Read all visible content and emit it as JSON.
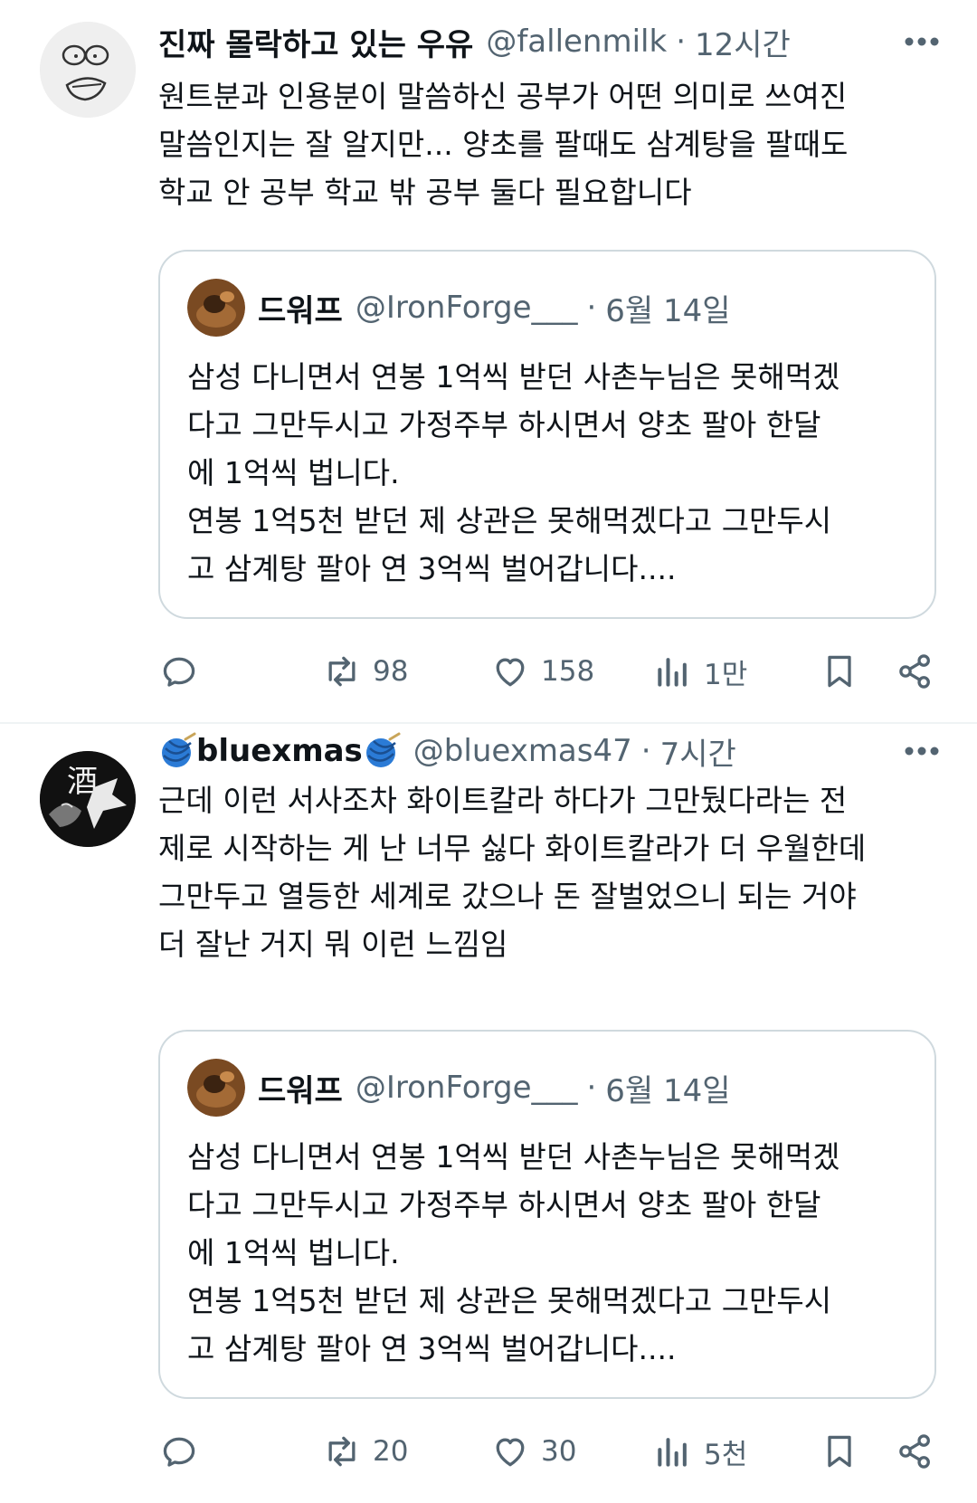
{
  "tweets": [
    {
      "display_name": "진짜 몰락하고 있는 우유",
      "handle": "@fallenmilk",
      "separator": "·",
      "time": "12시간",
      "text_lines": [
        "원트분과 인용분이 말씀하신 공부가 어떤 의미로 쓰여진",
        "말씀인지는 잘 알지만... 양초를 팔때도 삼계탕을 팔때도",
        "학교 안 공부 학교 밖 공부 둘다 필요합니다"
      ],
      "quote": {
        "display_name": "드워프",
        "handle": "@IronForge___",
        "separator": "·",
        "time": "6월 14일",
        "text_lines": [
          "삼성 다니면서 연봉 1억씩 받던 사촌누님은 못해먹겠",
          "다고 그만두시고 가정주부 하시면서 양초 팔아 한달",
          "에 1억씩 법니다.",
          "연봉 1억5천 받던 제 상관은 못해먹겠다고 그만두시",
          "고 삼계탕 팔아 연 3억씩 벌어갑니다...."
        ]
      },
      "stats": {
        "retweets": "98",
        "likes": "158",
        "views": "1만"
      }
    },
    {
      "display_name": "bluexmas",
      "handle": "@bluexmas47",
      "separator": "·",
      "time": "7시간",
      "text_lines": [
        "근데 이런 서사조차 화이트칼라 하다가 그만뒀다라는 전",
        "제로 시작하는 게 난 너무 싫다 화이트칼라가 더 우월한데",
        "그만두고 열등한 세계로 갔으나 돈 잘벌었으니 되는 거야",
        "더 잘난 거지 뭐 이런 느낌임"
      ],
      "quote": {
        "display_name": "드워프",
        "handle": "@IronForge___",
        "separator": "·",
        "time": "6월 14일",
        "text_lines": [
          "삼성 다니면서 연봉 1억씩 받던 사촌누님은 못해먹겠",
          "다고 그만두시고 가정주부 하시면서 양초 팔아 한달",
          "에 1억씩 법니다.",
          "연봉 1억5천 받던 제 상관은 못해먹겠다고 그만두시",
          "고 삼계탕 팔아 연 3억씩 벌어갑니다...."
        ]
      },
      "stats": {
        "retweets": "20",
        "likes": "30",
        "views": "5천"
      }
    }
  ],
  "avatars": {
    "tweet1": "cartoon-face-sketch",
    "tweet2": "black-white-ink-art-酒",
    "avatar_2_glyph": "酒",
    "quote": "brown-photo"
  },
  "icons": {
    "more": "ellipsis-icon",
    "reply": "reply-icon",
    "retweet": "retweet-icon",
    "like": "heart-icon",
    "views": "views-icon",
    "bookmark": "bookmark-icon",
    "share": "share-icon",
    "name_emoji": "yarn-ball-icon"
  },
  "colors": {
    "text": "#0f1419",
    "muted": "#536471",
    "border": "#cfd9de",
    "divider": "#eff3f4",
    "yarn": "#2b7bd6"
  }
}
